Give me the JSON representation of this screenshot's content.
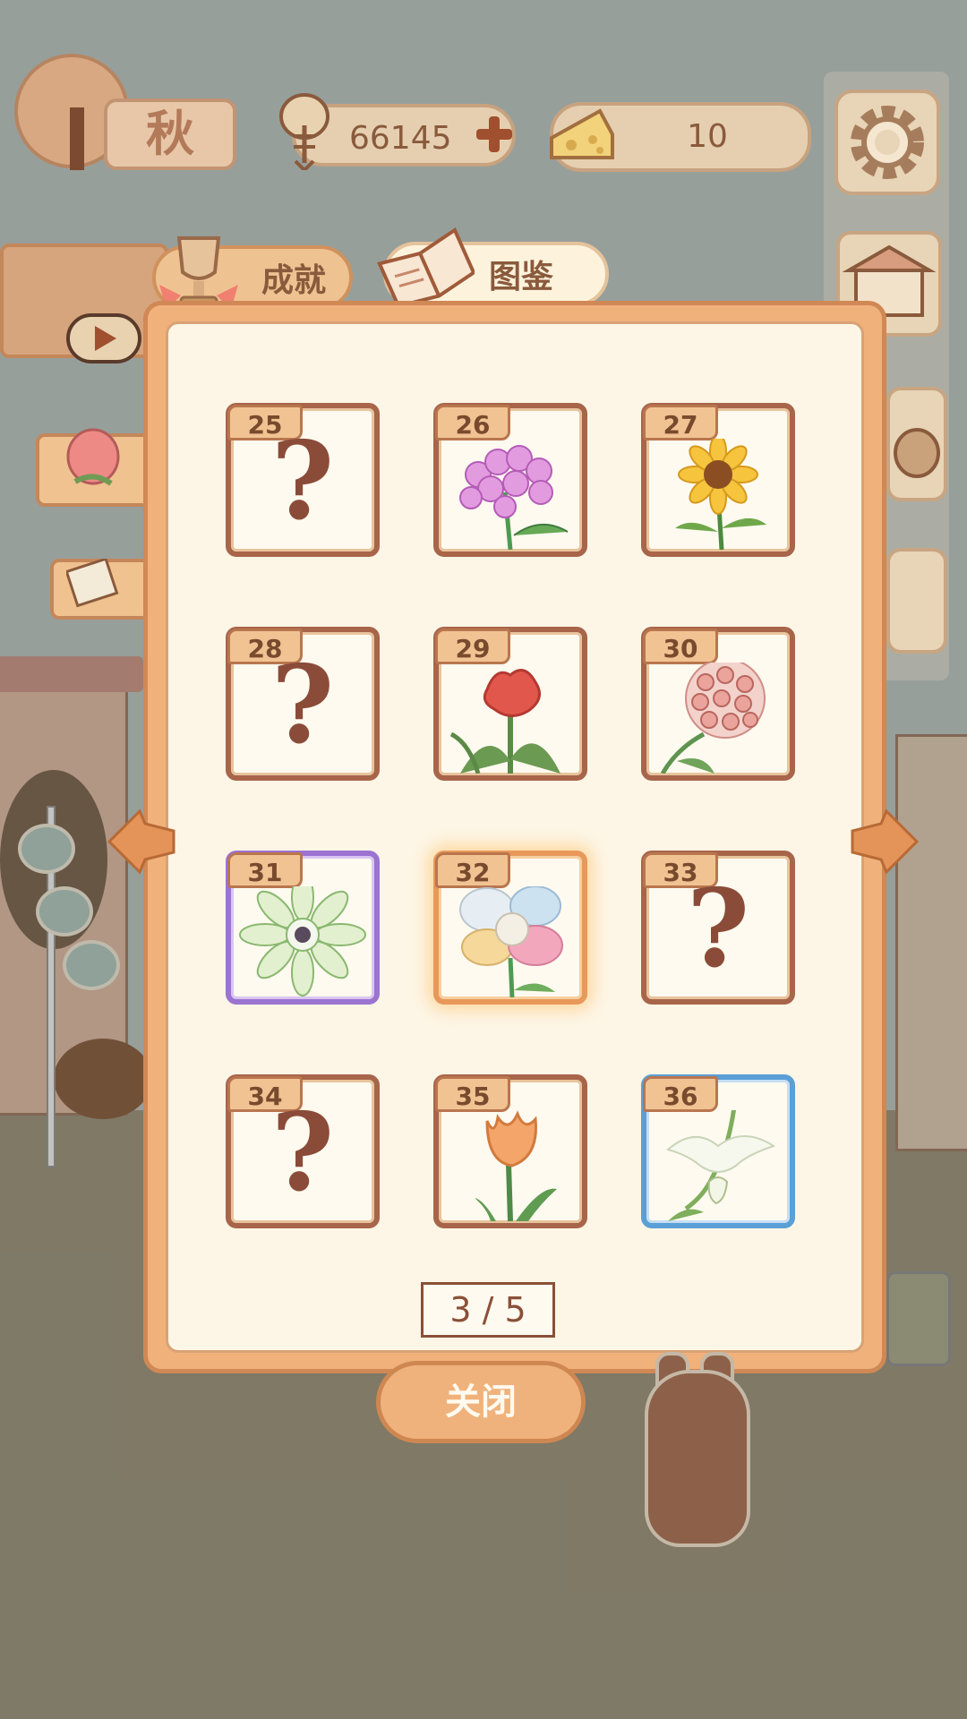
{
  "hud": {
    "season": "秋",
    "fish_count": "66145",
    "cheese_count": "10"
  },
  "tabs": {
    "achievement": "成就",
    "catalog": "图鉴"
  },
  "catalog": {
    "cells": [
      {
        "number": "25",
        "unlocked": false,
        "flower": "unknown",
        "frame": "brown"
      },
      {
        "number": "26",
        "unlocked": true,
        "flower": "pink-phlox",
        "frame": "brown"
      },
      {
        "number": "27",
        "unlocked": true,
        "flower": "sunflower",
        "frame": "brown"
      },
      {
        "number": "28",
        "unlocked": false,
        "flower": "unknown",
        "frame": "brown"
      },
      {
        "number": "29",
        "unlocked": true,
        "flower": "red-celosia",
        "frame": "brown"
      },
      {
        "number": "30",
        "unlocked": true,
        "flower": "hoya",
        "frame": "brown"
      },
      {
        "number": "31",
        "unlocked": true,
        "flower": "white-green-anemone",
        "frame": "purple"
      },
      {
        "number": "32",
        "unlocked": true,
        "flower": "rainbow-rose",
        "frame": "selected"
      },
      {
        "number": "33",
        "unlocked": false,
        "flower": "unknown",
        "frame": "brown"
      },
      {
        "number": "34",
        "unlocked": false,
        "flower": "unknown",
        "frame": "brown"
      },
      {
        "number": "35",
        "unlocked": true,
        "flower": "orange-tulip",
        "frame": "brown"
      },
      {
        "number": "36",
        "unlocked": true,
        "flower": "white-egret-orchid",
        "frame": "blue"
      }
    ],
    "unknown_mark": "?",
    "page_indicator": "3 / 5",
    "close_label": "关闭"
  },
  "colors": {
    "panel_orange": "#f0b17b",
    "panel_inner": "#fdf6e6",
    "frame_brown": "#a8654a",
    "frame_purple": "#9b73d1",
    "frame_blue": "#5a9fd6",
    "text_brown": "#8a5a3c"
  },
  "icons": [
    "season-tree-icon",
    "fish-bone-icon",
    "plus-icon",
    "cheese-icon",
    "gear-icon",
    "shop-stall-icon",
    "basket-icon",
    "trophy-icon",
    "book-icon",
    "flower-tab-icon",
    "photo-tab-icon",
    "play-icon",
    "left-arrow-icon",
    "right-arrow-icon"
  ]
}
